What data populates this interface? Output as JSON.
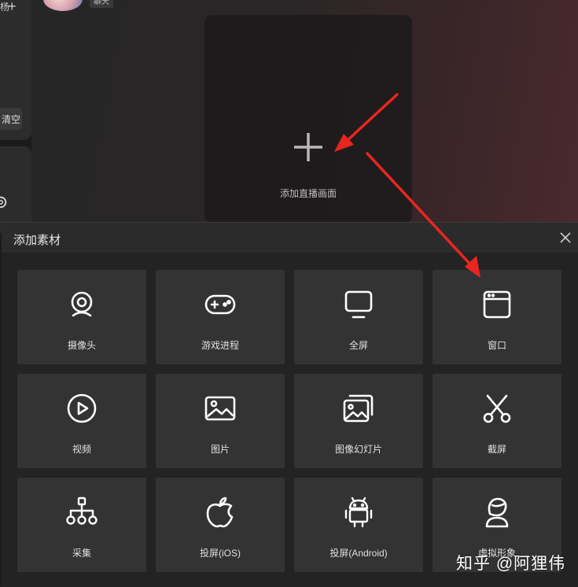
{
  "sidebar": {
    "top_label": "杨",
    "clear_label": "清空"
  },
  "top": {
    "chat_tag": "聊天"
  },
  "preview": {
    "label": "添加直播画面"
  },
  "dialog": {
    "title": "添加素材",
    "tiles": [
      {
        "label": "摄像头",
        "icon": "webcam-icon"
      },
      {
        "label": "游戏进程",
        "icon": "gamepad-icon"
      },
      {
        "label": "全屏",
        "icon": "monitor-icon"
      },
      {
        "label": "窗口",
        "icon": "window-icon"
      },
      {
        "label": "视频",
        "icon": "play-circle-icon"
      },
      {
        "label": "图片",
        "icon": "image-icon"
      },
      {
        "label": "图像幻灯片",
        "icon": "slideshow-icon"
      },
      {
        "label": "截屏",
        "icon": "scissors-icon"
      },
      {
        "label": "采集",
        "icon": "network-tree-icon"
      },
      {
        "label": "投屏(iOS)",
        "icon": "apple-icon"
      },
      {
        "label": "投屏(Android)",
        "icon": "android-icon"
      },
      {
        "label": "虚拟形象",
        "icon": "avatar-icon"
      }
    ]
  },
  "watermark": "知乎 @阿狸伟",
  "colors": {
    "annotation_arrow": "#e8261f",
    "tile_bg": "#333333",
    "dialog_bg": "#232323"
  }
}
